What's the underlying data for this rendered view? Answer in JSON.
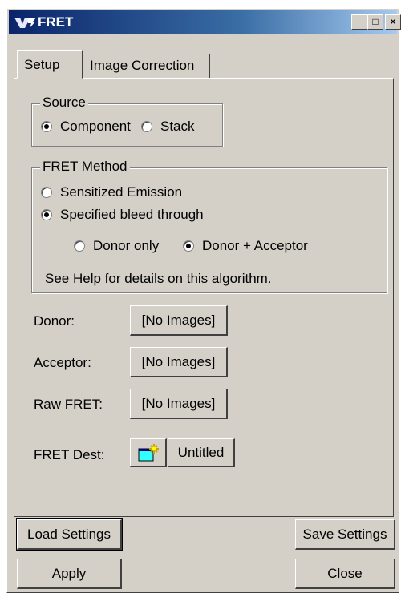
{
  "window": {
    "title": "FRET",
    "minimize_glyph": "_",
    "maximize_glyph": "□",
    "close_glyph": "×"
  },
  "tabs": [
    {
      "label": "Setup",
      "active": true
    },
    {
      "label": "Image Correction",
      "active": false
    }
  ],
  "source": {
    "legend": "Source",
    "options": [
      {
        "label": "Component",
        "checked": true
      },
      {
        "label": "Stack",
        "checked": false
      }
    ]
  },
  "fret_method": {
    "legend": "FRET Method",
    "options": [
      {
        "label": "Sensitized Emission",
        "checked": false
      },
      {
        "label": "Specified bleed through",
        "checked": true
      }
    ],
    "sub_options": [
      {
        "label": "Donor only",
        "checked": false
      },
      {
        "label": "Donor + Acceptor",
        "checked": true
      }
    ],
    "help_text": "See Help for details on this algorithm."
  },
  "images": {
    "donor_label": "Donor:",
    "donor_value": "[No Images]",
    "acceptor_label": "Acceptor:",
    "acceptor_value": "[No Images]",
    "raw_fret_label": "Raw FRET:",
    "raw_fret_value": "[No Images]",
    "dest_label": "FRET Dest:",
    "dest_value": "Untitled",
    "dest_icon": "new-window-icon"
  },
  "footer": {
    "load_settings": "Load Settings",
    "save_settings": "Save Settings",
    "apply": "Apply",
    "close": "Close"
  },
  "colors": {
    "face": "#d4d0c8",
    "titlebar_start": "#0a246a",
    "titlebar_end": "#a6caf0",
    "icon_cyan": "#33ffff",
    "icon_yellow": "#ffff00"
  }
}
